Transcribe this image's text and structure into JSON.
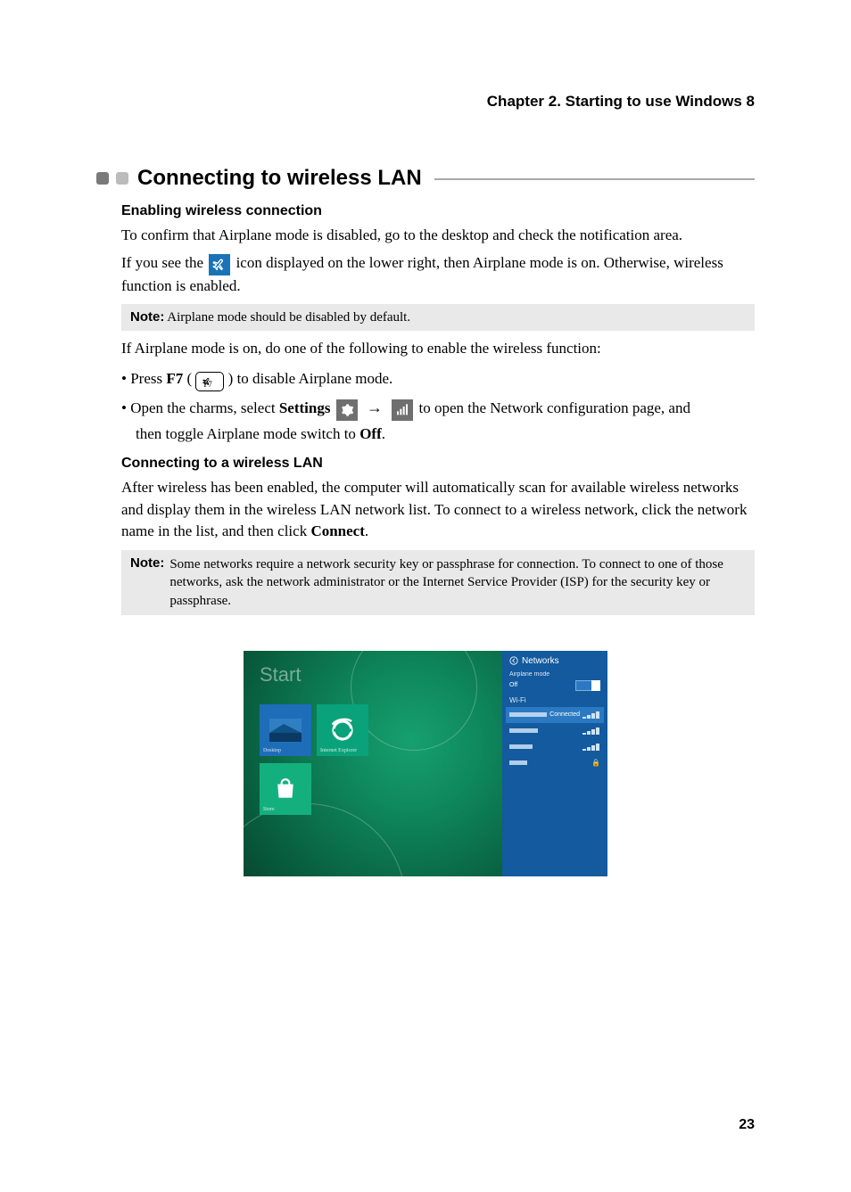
{
  "header": {
    "chapter": "Chapter 2. Starting to use Windows 8"
  },
  "section": {
    "title": "Connecting to wireless LAN"
  },
  "sub1": {
    "heading": "Enabling wireless connection",
    "p1": "To confirm that Airplane mode is disabled, go to the desktop and check the notification area.",
    "p2a": "If you see the ",
    "p2b": " icon displayed on the lower right, then Airplane mode is on. Otherwise, wireless function is enabled.",
    "note1_label": "Note:",
    "note1_text": " Airplane mode should be disabled by default.",
    "p3": "If Airplane mode is on, do one of the following to enable the wireless function:",
    "li1a": "Press ",
    "li1_key": "F7",
    "li1b": " ( ",
    "li1c": " ) to disable Airplane mode.",
    "keycap_sub": "F7",
    "li2a": "Open the charms, select ",
    "li2_settings": "Settings",
    "li2b": " to open the Network configuration page, and",
    "li2_cont_a": "then toggle Airplane mode switch to ",
    "li2_off": "Off",
    "li2_cont_b": "."
  },
  "sub2": {
    "heading": "Connecting to a wireless LAN",
    "p1": "After wireless has been enabled, the computer will automatically scan for available wireless networks and display them in the wireless LAN network list. To connect to a wireless network, click the network name in the list, and then click ",
    "p1_connect": "Connect",
    "p1_end": ".",
    "note_label": "Note:",
    "note_text": " Some networks require a network security key or passphrase for connection. To connect to one of those networks, ask the network administrator or the Internet Service Provider (ISP) for the security key or passphrase."
  },
  "figure": {
    "start_label": "Start",
    "tile_desktop": "Desktop",
    "tile_ie": "Internet Explorer",
    "tile_store": "Store",
    "net_title": "Networks",
    "net_mode_label": "Airplane mode",
    "net_mode_state": "Off",
    "wifi_label": "Wi-Fi",
    "connected": "Connected"
  },
  "page_number": "23"
}
